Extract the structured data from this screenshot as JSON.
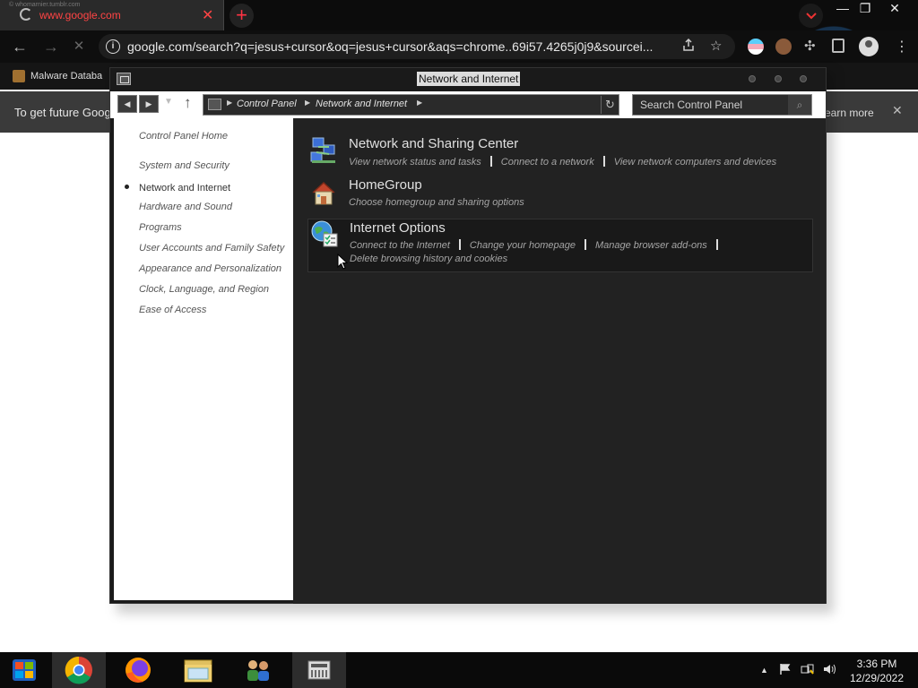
{
  "browser": {
    "tab": {
      "tiny_caption": "© whomarnier.tumblr.com",
      "title": "www.google.com",
      "close_glyph": "✕"
    },
    "new_tab_glyph": "+",
    "window_controls": {
      "minimize": "—",
      "restore": "❐",
      "close": "✕"
    },
    "nav": {
      "back": "←",
      "forward": "→",
      "stop": "✕"
    },
    "omnibox": {
      "info_glyph": "i",
      "url": "google.com/search?q=jesus+cursor&oq=jesus+cursor&aqs=chrome..69i57.4265j0j9&sourcei...",
      "share_icon": "share-icon",
      "star_icon": "star-icon"
    },
    "bookmark": {
      "label": "Malware Databa"
    },
    "infobar": {
      "text": "To get future Goog",
      "learn_more": "earn more",
      "close_glyph": "✕"
    }
  },
  "control_panel": {
    "title": "Network and Internet",
    "nav": {
      "back": "◀",
      "forward": "▶",
      "recent": "▼",
      "up": "↑"
    },
    "breadcrumb": [
      "Control Panel",
      "Network and Internet"
    ],
    "refresh_glyph": "↻",
    "search_placeholder": "Search Control Panel",
    "search_glyph": "⌕",
    "sidebar": {
      "home": "Control Panel Home",
      "items": [
        "System and Security",
        "Network and Internet",
        "Hardware and Sound",
        "Programs",
        "User Accounts and Family Safety",
        "Appearance and Personalization",
        "Clock, Language, and Region",
        "Ease of Access"
      ]
    },
    "categories": [
      {
        "title": "Network and Sharing Center",
        "links": [
          "View network status and tasks",
          "Connect to a network",
          "View network computers and devices"
        ]
      },
      {
        "title": "HomeGroup",
        "links": [
          "Choose homegroup and sharing options"
        ]
      },
      {
        "title": "Internet Options",
        "links": [
          "Connect to the Internet",
          "Change your homepage",
          "Manage browser add-ons",
          "Delete browsing history and cookies"
        ]
      }
    ]
  },
  "taskbar": {
    "apps": [
      "start-orb-icon",
      "chrome-icon",
      "firefox-icon",
      "file-explorer-icon",
      "users-icon",
      "control-panel-icon"
    ],
    "tray": {
      "show_hidden": "▲"
    },
    "time": "3:36 PM",
    "date": "12/29/2022"
  },
  "colors": {
    "window_bg": "#222222",
    "sidebar_bg": "#ffffff",
    "taskbar_bg": "#0a0a0a",
    "tab_title": "#ff4444"
  }
}
